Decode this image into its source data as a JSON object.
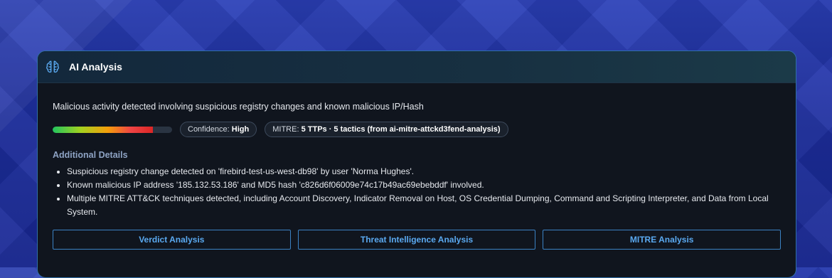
{
  "header": {
    "title": "AI Analysis",
    "icon": "brain-icon"
  },
  "summary": "Malicious activity detected involving suspicious registry changes and known malicious IP/Hash",
  "confidence": {
    "bar_fraction": 0.84,
    "label": "Confidence:",
    "value": "High"
  },
  "mitre": {
    "label": "MITRE:",
    "value": "5 TTPs · 5 tactics (from ai-mitre-attckd3fend-analysis)"
  },
  "details": {
    "title": "Additional Details",
    "items": [
      "Suspicious registry change detected on 'firebird-test-us-west-db98' by user 'Norma Hughes'.",
      "Known malicious IP address '185.132.53.186' and MD5 hash 'c826d6f06009e74c17b49ac69ebebddf' involved.",
      "Multiple MITRE ATT&CK techniques detected, including Account Discovery, Indicator Removal on Host, OS Credential Dumping, Command and Scripting Interpreter, and Data from Local System."
    ]
  },
  "buttons": {
    "verdict": "Verdict Analysis",
    "threat_intel": "Threat Intelligence Analysis",
    "mitre": "MITRE Analysis"
  },
  "colors": {
    "accent": "#5aa9f0",
    "card_border": "#2f6fa8",
    "card_bg": "#10151e"
  }
}
